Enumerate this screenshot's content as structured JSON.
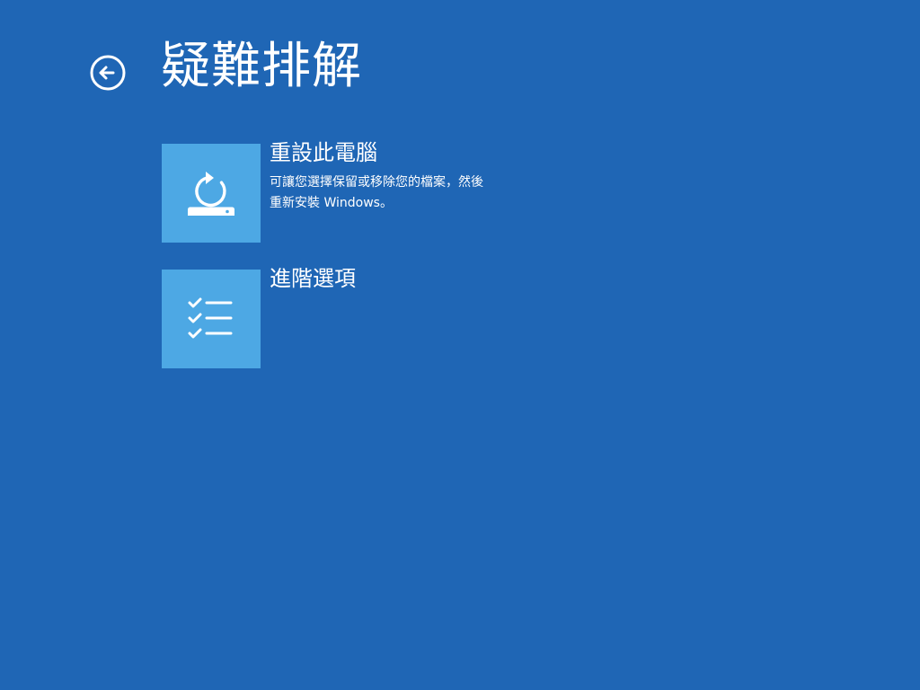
{
  "page": {
    "title": "疑難排解",
    "back_icon": "back-arrow-icon"
  },
  "options": [
    {
      "title": "重設此電腦",
      "description": "可讓您選擇保留或移除您的檔案，然後重新安裝 Windows。",
      "icon": "reset-pc-icon"
    },
    {
      "title": "進階選項",
      "description": "",
      "icon": "checklist-icon"
    }
  ],
  "colors": {
    "background": "#1f66b5",
    "tile": "#4da8e4",
    "text": "#ffffff"
  }
}
